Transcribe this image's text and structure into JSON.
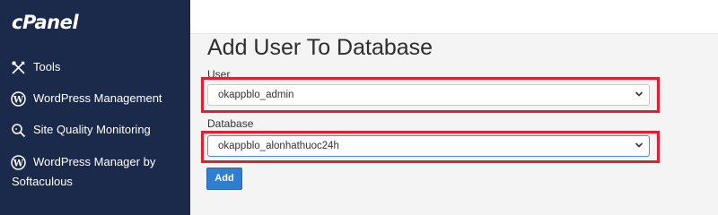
{
  "sidebar": {
    "logo": "cPanel",
    "items": [
      {
        "label": "Tools",
        "icon": "tools-icon"
      },
      {
        "label": "WordPress Management",
        "icon": "wordpress-icon"
      },
      {
        "label": "Site Quality Monitoring",
        "icon": "search-icon"
      },
      {
        "label": "WordPress Manager by",
        "label2": "Softaculous",
        "icon": "wordpress-icon"
      }
    ]
  },
  "main": {
    "title": "Add User To Database",
    "user_label": "User",
    "user_value": "okappblo_admin",
    "database_label": "Database",
    "database_value": "okappblo_alonhathuoc24h",
    "add_button": "Add"
  },
  "colors": {
    "sidebar_bg": "#1b2a4b",
    "highlight": "#e02030",
    "button": "#2f7fd1"
  }
}
